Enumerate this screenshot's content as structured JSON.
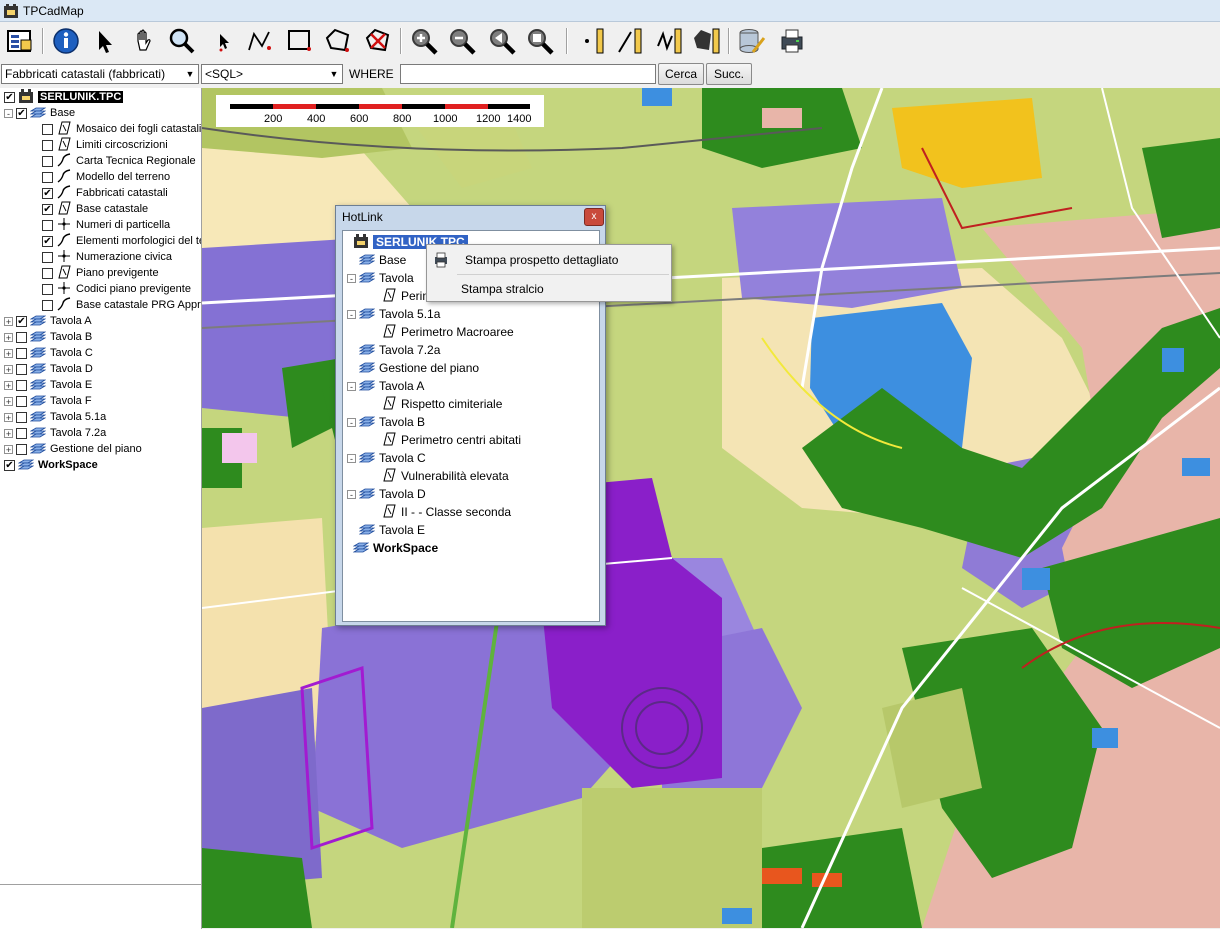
{
  "window": {
    "title": "TPCadMap"
  },
  "query": {
    "layer_select": "Fabbricati catastali (fabbricati)",
    "sql_select": "<SQL>",
    "where_label": "WHERE",
    "where_value": "",
    "find_label": "Cerca",
    "next_label": "Succ."
  },
  "toolbar": {
    "items": [
      "layer-manager-icon",
      "info-icon",
      "pointer-icon",
      "pan-hand-icon",
      "magnifier-icon",
      "small-pointer-icon",
      "select-line-icon",
      "select-rect-icon",
      "select-polygon-icon",
      "clear-selection-icon",
      "zoom-in-icon",
      "zoom-out-icon",
      "zoom-previous-icon",
      "zoom-extent-icon",
      "measure-point-icon",
      "measure-line-icon",
      "measure-polyline-icon",
      "measure-area-icon",
      "database-edit-icon",
      "print-icon"
    ]
  },
  "tree": {
    "root": "SERLUNIK.TPC",
    "base": "Base",
    "base_children": [
      {
        "label": "Mosaico dei fogli catastali",
        "checked": false,
        "icon": "raster"
      },
      {
        "label": "Limiti circoscrizioni",
        "checked": false,
        "icon": "raster"
      },
      {
        "label": "Carta Tecnica Regionale",
        "checked": false,
        "icon": "line"
      },
      {
        "label": "Modello del terreno",
        "checked": false,
        "icon": "line"
      },
      {
        "label": "Fabbricati catastali",
        "checked": true,
        "icon": "line"
      },
      {
        "label": "Base catastale",
        "checked": true,
        "icon": "raster"
      },
      {
        "label": "Numeri di particella",
        "checked": false,
        "icon": "point"
      },
      {
        "label": "Elementi morfologici del terreno",
        "checked": true,
        "icon": "line"
      },
      {
        "label": "Numerazione civica",
        "checked": false,
        "icon": "point"
      },
      {
        "label": "Piano previgente",
        "checked": false,
        "icon": "raster"
      },
      {
        "label": "Codici piano previgente",
        "checked": false,
        "icon": "point"
      },
      {
        "label": "Base catastale PRG Approvato",
        "checked": false,
        "icon": "line"
      }
    ],
    "groups": [
      {
        "label": "Tavola A",
        "checked": true
      },
      {
        "label": "Tavola B",
        "checked": false
      },
      {
        "label": "Tavola C",
        "checked": false
      },
      {
        "label": "Tavola D",
        "checked": false
      },
      {
        "label": "Tavola E",
        "checked": false
      },
      {
        "label": "Tavola F",
        "checked": false
      },
      {
        "label": "Tavola 5.1a",
        "checked": false
      },
      {
        "label": "Tavola 7.2a",
        "checked": false
      },
      {
        "label": "Gestione del piano",
        "checked": false
      }
    ],
    "workspace": "WorkSpace"
  },
  "scale_bar": {
    "labels": [
      "200",
      "400",
      "600",
      "800",
      "1000",
      "1200",
      "1400"
    ]
  },
  "hotlink": {
    "title": "HotLink",
    "close_glyph": "x",
    "root": "SERLUNIK.TPC",
    "items": [
      {
        "label": "Base",
        "level": 1,
        "type": "group"
      },
      {
        "label": "Tavola",
        "level": 1,
        "type": "group",
        "expander": "-"
      },
      {
        "label": "Perimetri macroaree",
        "level": 2,
        "type": "layer"
      },
      {
        "label": "Tavola 5.1a",
        "level": 1,
        "type": "group",
        "expander": "-"
      },
      {
        "label": "Perimetro Macroaree",
        "level": 2,
        "type": "layer"
      },
      {
        "label": "Tavola 7.2a",
        "level": 1,
        "type": "group"
      },
      {
        "label": "Gestione del piano",
        "level": 1,
        "type": "group"
      },
      {
        "label": "Tavola A",
        "level": 1,
        "type": "group",
        "expander": "-"
      },
      {
        "label": "Rispetto cimiteriale",
        "level": 2,
        "type": "layer"
      },
      {
        "label": "Tavola B",
        "level": 1,
        "type": "group",
        "expander": "-"
      },
      {
        "label": "Perimetro centri abitati",
        "level": 2,
        "type": "layer"
      },
      {
        "label": "Tavola C",
        "level": 1,
        "type": "group",
        "expander": "-"
      },
      {
        "label": "Vulnerabilità elevata",
        "level": 2,
        "type": "layer"
      },
      {
        "label": "Tavola D",
        "level": 1,
        "type": "group",
        "expander": "-"
      },
      {
        "label": "II - - Classe seconda",
        "level": 2,
        "type": "layer"
      },
      {
        "label": "Tavola E",
        "level": 1,
        "type": "group"
      }
    ],
    "workspace": "WorkSpace"
  },
  "context_menu": {
    "items": [
      "Stampa prospetto dettagliato",
      "Stampa stralcio"
    ]
  },
  "colors": {
    "titlebar": "#dbe8f5",
    "map_green": "#2e8b1e",
    "map_olive": "#b9c96a",
    "map_purple": "#8a72d6",
    "map_magenta": "#8e1fc7",
    "map_blue": "#3d8fe0",
    "map_pink": "#e6b2a8",
    "selection": "#3163c5"
  }
}
